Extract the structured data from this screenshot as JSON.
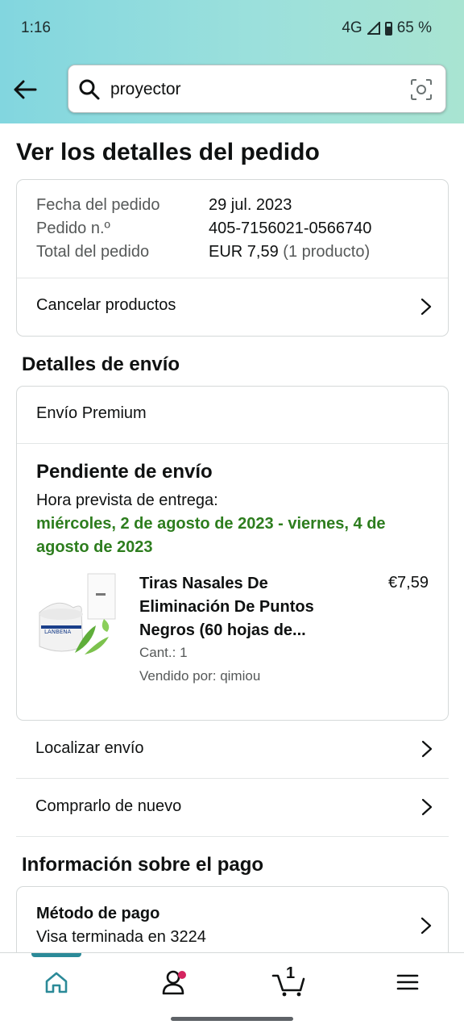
{
  "status": {
    "time": "1:16",
    "network": "4G",
    "battery": "65 %"
  },
  "search": {
    "query": "proyector"
  },
  "page_title": "Ver los detalles del pedido",
  "order": {
    "date_label": "Fecha del pedido",
    "date_value": "29 jul. 2023",
    "number_label": "Pedido n.º",
    "number_value": "405-7156021-0566740",
    "total_label": "Total del pedido",
    "total_value": "EUR 7,59",
    "total_count": "(1 producto)",
    "cancel_label": "Cancelar productos"
  },
  "shipping": {
    "section_title": "Detalles de envío",
    "method": "Envío Premium",
    "status_title": "Pendiente de envío",
    "eta_label": "Hora prevista de entrega:",
    "eta_value": "miércoles, 2 de agosto de 2023 - viernes, 4 de agosto de 2023",
    "product": {
      "name": "Tiras Nasales De Eliminación De Puntos Negros (60 hojas de...",
      "price": "€7,59",
      "quantity": "Cant.: 1",
      "seller": "Vendido por: qimiou",
      "image_brand": "LANBENA"
    },
    "track_label": "Localizar envío",
    "buy_again_label": "Comprarlo de nuevo"
  },
  "payment": {
    "section_title": "Información sobre el pago",
    "method_title": "Método de pago",
    "method_value": "Visa terminada en 3224"
  },
  "nav": {
    "cart_count": "1"
  },
  "colors": {
    "accent": "#2b8a98",
    "eta_green": "#2d7d1e",
    "badge": "#d4245f"
  }
}
